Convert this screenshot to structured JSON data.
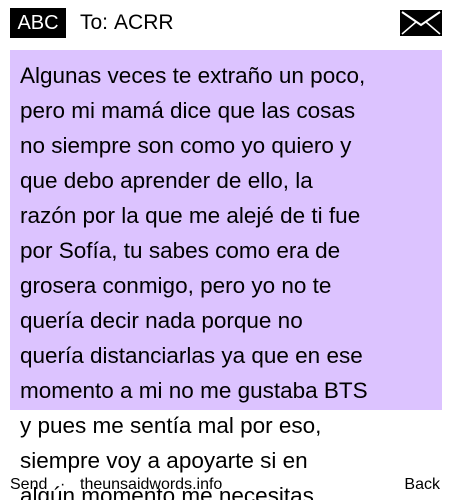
{
  "header": {
    "mode_label": "ABC",
    "to_prefix": "To:",
    "recipient": "ACRR",
    "envelope_icon": "envelope-icon"
  },
  "message": {
    "body": "Algunas veces te extraño un poco,\npero mi mamá dice que las cosas\nno siempre son como yo quiero y\nque debo aprender de ello, la\nrazón por la que me alejé de ti fue\npor Sofía, tu sabes como era de\ngrosera conmigo, pero yo no te\nquería decir nada porque no\nquería distanciarlas ya que en ese\nmomento a mi no me gustaba BTS\ny pues me sentía mal por eso,\nsiempre voy a apoyarte si en\nalgún momento me necesitas",
    "highlight_color": "#dcc3ff"
  },
  "softkeys": {
    "left_label": "Send",
    "separator": "·",
    "site": "theunsaidwords.info",
    "right_label": "Back"
  }
}
